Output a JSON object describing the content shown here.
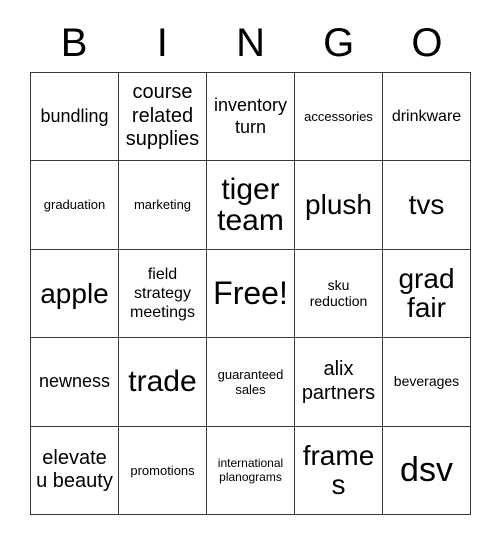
{
  "card": {
    "title": "BINGO",
    "header_letters": [
      "B",
      "I",
      "N",
      "G",
      "O"
    ],
    "colors": {
      "background": "#ffffff",
      "text": "#000000",
      "grid_line": "#3a3a3a"
    },
    "free_space": "Free!",
    "rows": [
      [
        {
          "text": "bundling",
          "size": "fs-ml"
        },
        {
          "text": "course related supplies",
          "size": "fs-l"
        },
        {
          "text": "inventory turn",
          "size": "fs-ml"
        },
        {
          "text": "accessories",
          "size": "fs-s"
        },
        {
          "text": "drinkware",
          "size": "fs-m"
        }
      ],
      [
        {
          "text": "graduation",
          "size": "fs-s"
        },
        {
          "text": "marketing",
          "size": "fs-s"
        },
        {
          "text": "tiger team",
          "size": "fs-h1"
        },
        {
          "text": "plush",
          "size": "fs-xxl"
        },
        {
          "text": "tvs",
          "size": "fs-xxl"
        }
      ],
      [
        {
          "text": "apple",
          "size": "fs-xxl"
        },
        {
          "text": "field strategy meetings",
          "size": "fs-m"
        },
        {
          "text": "Free!",
          "size": "fs-h2"
        },
        {
          "text": "sku reduction",
          "size": "fs-sm"
        },
        {
          "text": "grad fair",
          "size": "fs-xxl"
        }
      ],
      [
        {
          "text": "newness",
          "size": "fs-ml"
        },
        {
          "text": "trade",
          "size": "fs-h1"
        },
        {
          "text": "guaranteed sales",
          "size": "fs-s"
        },
        {
          "text": "alix partners",
          "size": "fs-l"
        },
        {
          "text": "beverages",
          "size": "fs-sm"
        }
      ],
      [
        {
          "text": "elevate u beauty",
          "size": "fs-l"
        },
        {
          "text": "promotions",
          "size": "fs-s"
        },
        {
          "text": "international planograms",
          "size": "fs-xs"
        },
        {
          "text": "frames",
          "size": "fs-xxl"
        },
        {
          "text": "dsv",
          "size": "fs-h3"
        }
      ]
    ]
  }
}
